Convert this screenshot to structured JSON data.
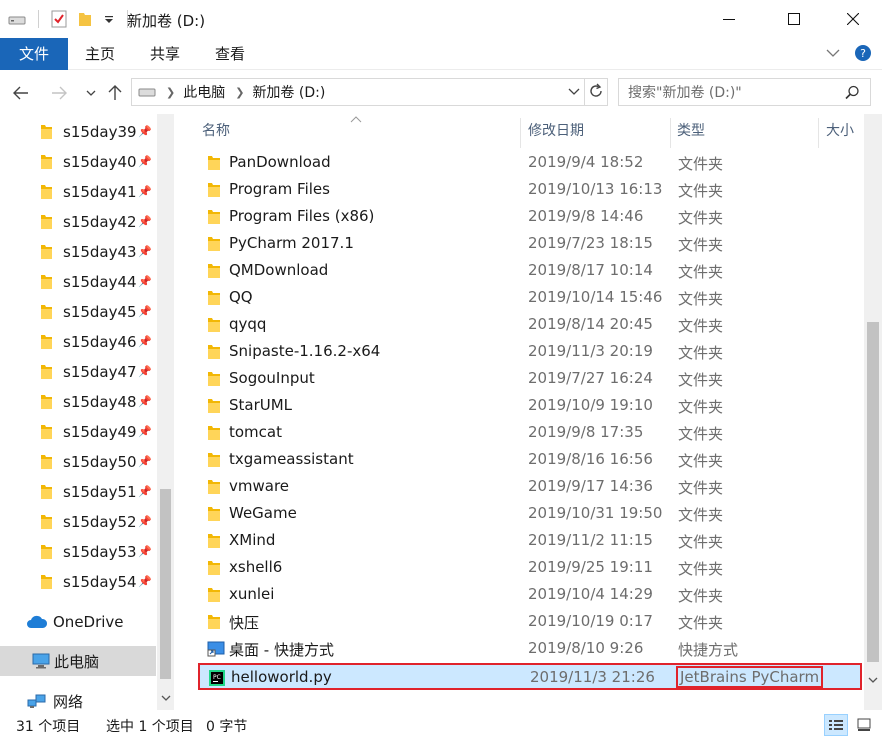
{
  "window": {
    "title": "新加卷 (D:)",
    "minimize_glyph": "—",
    "maximize_glyph": "☐",
    "close_glyph": "✕"
  },
  "ribbon": {
    "tabs": [
      "文件",
      "主页",
      "共享",
      "查看"
    ],
    "accent": "#1a66b8"
  },
  "address": {
    "segments": [
      "此电脑",
      "新加卷 (D:)"
    ],
    "search_placeholder": "搜索\"新加卷 (D:)\""
  },
  "nav_pane": {
    "quick_access": [
      "s15day39",
      "s15day40",
      "s15day41",
      "s15day42",
      "s15day43",
      "s15day44",
      "s15day45",
      "s15day46",
      "s15day47",
      "s15day48",
      "s15day49",
      "s15day50",
      "s15day51",
      "s15day52",
      "s15day53",
      "s15day54"
    ],
    "onedrive": "OneDrive",
    "this_pc": "此电脑",
    "network": "网络"
  },
  "columns": {
    "name": "名称",
    "date": "修改日期",
    "type": "类型",
    "size": "大小"
  },
  "files": [
    {
      "name": "PanDownload",
      "date": "2019/9/4 18:52",
      "type": "文件夹",
      "icon": "folder-icon"
    },
    {
      "name": "Program Files",
      "date": "2019/10/13 16:13",
      "type": "文件夹",
      "icon": "folder-icon"
    },
    {
      "name": "Program Files (x86)",
      "date": "2019/9/8 14:46",
      "type": "文件夹",
      "icon": "folder-icon"
    },
    {
      "name": "PyCharm 2017.1",
      "date": "2019/7/23 18:15",
      "type": "文件夹",
      "icon": "folder-icon"
    },
    {
      "name": "QMDownload",
      "date": "2019/8/17 10:14",
      "type": "文件夹",
      "icon": "folder-icon"
    },
    {
      "name": "QQ",
      "date": "2019/10/14 15:46",
      "type": "文件夹",
      "icon": "folder-icon"
    },
    {
      "name": "qyqq",
      "date": "2019/8/14 20:45",
      "type": "文件夹",
      "icon": "folder-icon"
    },
    {
      "name": "Snipaste-1.16.2-x64",
      "date": "2019/11/3 20:19",
      "type": "文件夹",
      "icon": "folder-icon"
    },
    {
      "name": "SogouInput",
      "date": "2019/7/27 16:24",
      "type": "文件夹",
      "icon": "folder-icon"
    },
    {
      "name": "StarUML",
      "date": "2019/10/9 19:10",
      "type": "文件夹",
      "icon": "folder-icon"
    },
    {
      "name": "tomcat",
      "date": "2019/9/8 17:35",
      "type": "文件夹",
      "icon": "folder-icon"
    },
    {
      "name": "txgameassistant",
      "date": "2019/8/16 16:56",
      "type": "文件夹",
      "icon": "folder-icon"
    },
    {
      "name": "vmware",
      "date": "2019/9/17 14:36",
      "type": "文件夹",
      "icon": "folder-icon"
    },
    {
      "name": "WeGame",
      "date": "2019/10/31 19:50",
      "type": "文件夹",
      "icon": "folder-icon"
    },
    {
      "name": "XMind",
      "date": "2019/11/2 11:15",
      "type": "文件夹",
      "icon": "folder-icon"
    },
    {
      "name": "xshell6",
      "date": "2019/9/25 19:11",
      "type": "文件夹",
      "icon": "folder-icon"
    },
    {
      "name": "xunlei",
      "date": "2019/10/4 14:29",
      "type": "文件夹",
      "icon": "folder-icon"
    },
    {
      "name": "快压",
      "date": "2019/10/19 0:17",
      "type": "文件夹",
      "icon": "folder-icon"
    },
    {
      "name": "桌面 - 快捷方式",
      "date": "2019/8/10 9:26",
      "type": "快捷方式",
      "icon": "shortcut-icon"
    },
    {
      "name": "helloworld.py",
      "date": "2019/11/3 21:26",
      "type": "JetBrains PyCharm",
      "icon": "pycharm-file-icon",
      "selected": true
    }
  ],
  "status": {
    "item_count": "31 个项目",
    "selected": "选中 1 个项目",
    "size": "0 字节"
  }
}
